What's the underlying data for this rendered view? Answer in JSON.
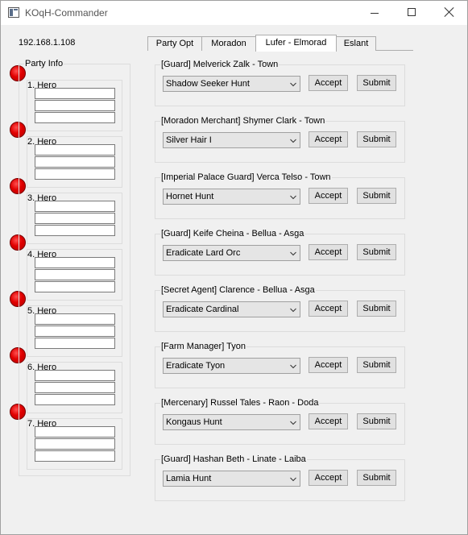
{
  "window": {
    "title": "KOqH-Commander"
  },
  "connection": {
    "ip": "192.168.1.108"
  },
  "party": {
    "label": "Party Info",
    "heroes": [
      {
        "label": "1. Hero"
      },
      {
        "label": "2. Hero"
      },
      {
        "label": "3. Hero"
      },
      {
        "label": "4. Hero"
      },
      {
        "label": "5. Hero"
      },
      {
        "label": "6. Hero"
      },
      {
        "label": "7. Hero"
      }
    ],
    "status_color": "#e00000"
  },
  "tabs": [
    {
      "label": "Party Opt",
      "active": false
    },
    {
      "label": "Moradon",
      "active": false
    },
    {
      "label": "Lufer - Elmorad",
      "active": true
    },
    {
      "label": "Eslant",
      "active": false
    }
  ],
  "buttons": {
    "accept": "Accept",
    "submit": "Submit"
  },
  "quests": [
    {
      "npc": "[Guard] Melverick Zalk - Town",
      "selected": "Shadow Seeker Hunt"
    },
    {
      "npc": "[Moradon Merchant] Shymer Clark - Town",
      "selected": "Silver Hair I"
    },
    {
      "npc": "[Imperial Palace Guard] Verca Telso - Town",
      "selected": "Hornet Hunt"
    },
    {
      "npc": "[Guard] Keife Cheina - Bellua - Asga",
      "selected": "Eradicate Lard Orc"
    },
    {
      "npc": "[Secret Agent] Clarence - Bellua - Asga",
      "selected": "Eradicate Cardinal"
    },
    {
      "npc": "[Farm Manager] Tyon",
      "selected": "Eradicate Tyon"
    },
    {
      "npc": "[Mercenary] Russel Tales - Raon - Doda",
      "selected": "Kongaus Hunt"
    },
    {
      "npc": "[Guard] Hashan Beth - Linate - Laiba",
      "selected": "Lamia Hunt"
    }
  ]
}
